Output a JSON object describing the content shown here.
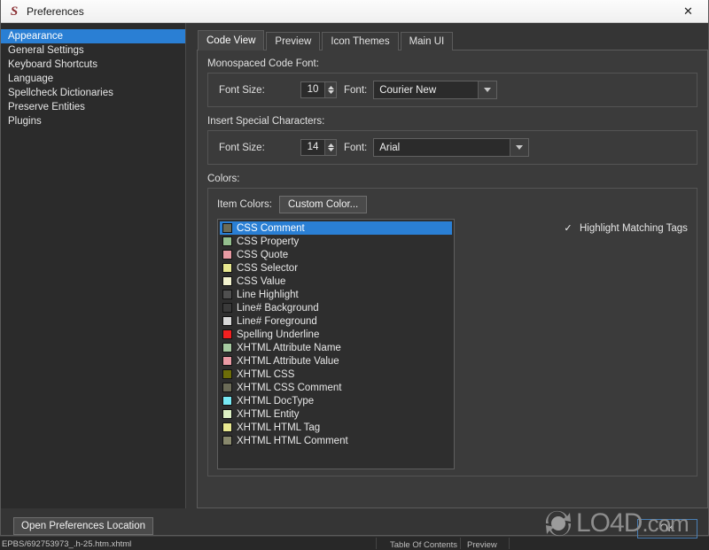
{
  "window": {
    "title": "Preferences",
    "logo_icon": "sigil-s-logo-icon",
    "logo_color": "#8b2f33",
    "close_icon": "✕"
  },
  "sidebar": {
    "items": [
      {
        "label": "Appearance",
        "selected": true
      },
      {
        "label": "General Settings",
        "selected": false
      },
      {
        "label": "Keyboard Shortcuts",
        "selected": false
      },
      {
        "label": "Language",
        "selected": false
      },
      {
        "label": "Spellcheck Dictionaries",
        "selected": false
      },
      {
        "label": "Preserve Entities",
        "selected": false
      },
      {
        "label": "Plugins",
        "selected": false
      }
    ],
    "selection_color": "#2a7fd4"
  },
  "tabs": [
    {
      "label": "Code View",
      "active": true
    },
    {
      "label": "Preview",
      "active": false
    },
    {
      "label": "Icon Themes",
      "active": false
    },
    {
      "label": "Main UI",
      "active": false
    }
  ],
  "code_view": {
    "mono_group": {
      "title": "Monospaced Code Font:",
      "font_size_label": "Font Size:",
      "font_size_value": "10",
      "font_label": "Font:",
      "font_value": "Courier New"
    },
    "special_group": {
      "title": "Insert Special Characters:",
      "font_size_label": "Font Size:",
      "font_size_value": "14",
      "font_label": "Font:",
      "font_value": "Arial"
    },
    "colors_group": {
      "title": "Colors:",
      "item_colors_label": "Item Colors:",
      "custom_color_label": "Custom Color...",
      "highlight_checkbox": {
        "label": "Highlight Matching Tags",
        "checked": true,
        "check_glyph": "✓"
      },
      "items": [
        {
          "label": "CSS Comment",
          "swatch": "#6b6b57",
          "selected": true
        },
        {
          "label": "CSS Property",
          "swatch": "#94bf8e",
          "selected": false
        },
        {
          "label": "CSS Quote",
          "swatch": "#e79aa2",
          "selected": false
        },
        {
          "label": "CSS Selector",
          "swatch": "#e8e88f",
          "selected": false
        },
        {
          "label": "CSS Value",
          "swatch": "#f3f3cf",
          "selected": false
        },
        {
          "label": "Line Highlight",
          "swatch": "#4f4f4f",
          "selected": false
        },
        {
          "label": "Line# Background",
          "swatch": "#3a3a3a",
          "selected": false
        },
        {
          "label": "Line# Foreground",
          "swatch": "#d8d8d8",
          "selected": false
        },
        {
          "label": "Spelling Underline",
          "swatch": "#f32020",
          "selected": false
        },
        {
          "label": "XHTML Attribute Name",
          "swatch": "#a7cba1",
          "selected": false
        },
        {
          "label": "XHTML Attribute Value",
          "swatch": "#ea9aa4",
          "selected": false
        },
        {
          "label": "XHTML CSS",
          "swatch": "#6d6d08",
          "selected": false
        },
        {
          "label": "XHTML CSS Comment",
          "swatch": "#6b6b57",
          "selected": false
        },
        {
          "label": "XHTML DocType",
          "swatch": "#78eaf5",
          "selected": false
        },
        {
          "label": "XHTML Entity",
          "swatch": "#ddf0c4",
          "selected": false
        },
        {
          "label": "XHTML HTML Tag",
          "swatch": "#e8e890",
          "selected": false
        },
        {
          "label": "XHTML HTML Comment",
          "swatch": "#88886c",
          "selected": false
        }
      ]
    }
  },
  "footer": {
    "open_prefs_label": "Open Preferences Location",
    "ok_label": "OK"
  },
  "watermark": {
    "text": "LO4D",
    "suffix": ".com",
    "color": "#8d8d8d"
  },
  "host_app": {
    "status_path": "EPBS/692753973_.h-25.htm.xhtml",
    "status_toc": "Table Of Contents",
    "status_preview": "Preview",
    "bg_rows": [
      "DE",
      "DE",
      "DE",
      "DE",
      "DE",
      "DE",
      "DE",
      "DE",
      "DE",
      "DE",
      "DE",
      "DE",
      "DE",
      "DE",
      "DE",
      "DE",
      "DE",
      "DE",
      "DE",
      "DE",
      "DE"
    ],
    "bg_selected_row_index": 11
  }
}
